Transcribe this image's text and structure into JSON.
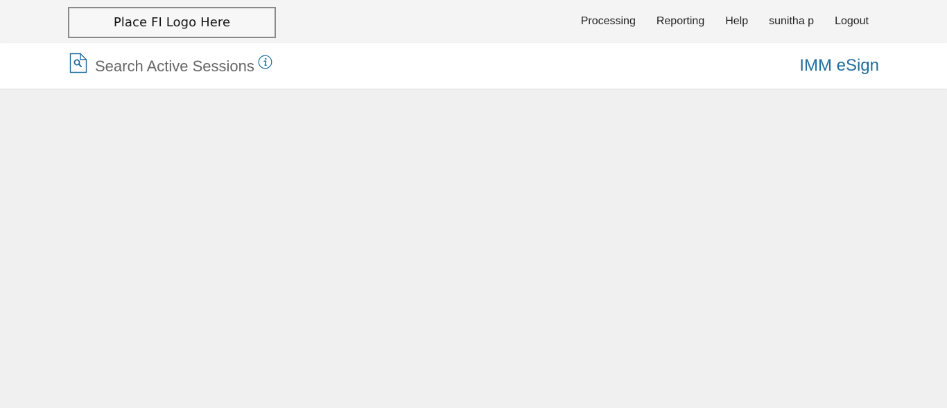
{
  "header": {
    "logo_text": "Place FI Logo Here",
    "nav": [
      {
        "label": "Processing"
      },
      {
        "label": "Reporting"
      },
      {
        "label": "Help"
      },
      {
        "label": "sunitha p"
      },
      {
        "label": "Logout"
      }
    ]
  },
  "subheader": {
    "icon": "search-document-icon",
    "title": "Search Active Sessions",
    "info_icon": "info-icon",
    "brand": "IMM eSign",
    "accent_color": "#1f6ea0"
  }
}
